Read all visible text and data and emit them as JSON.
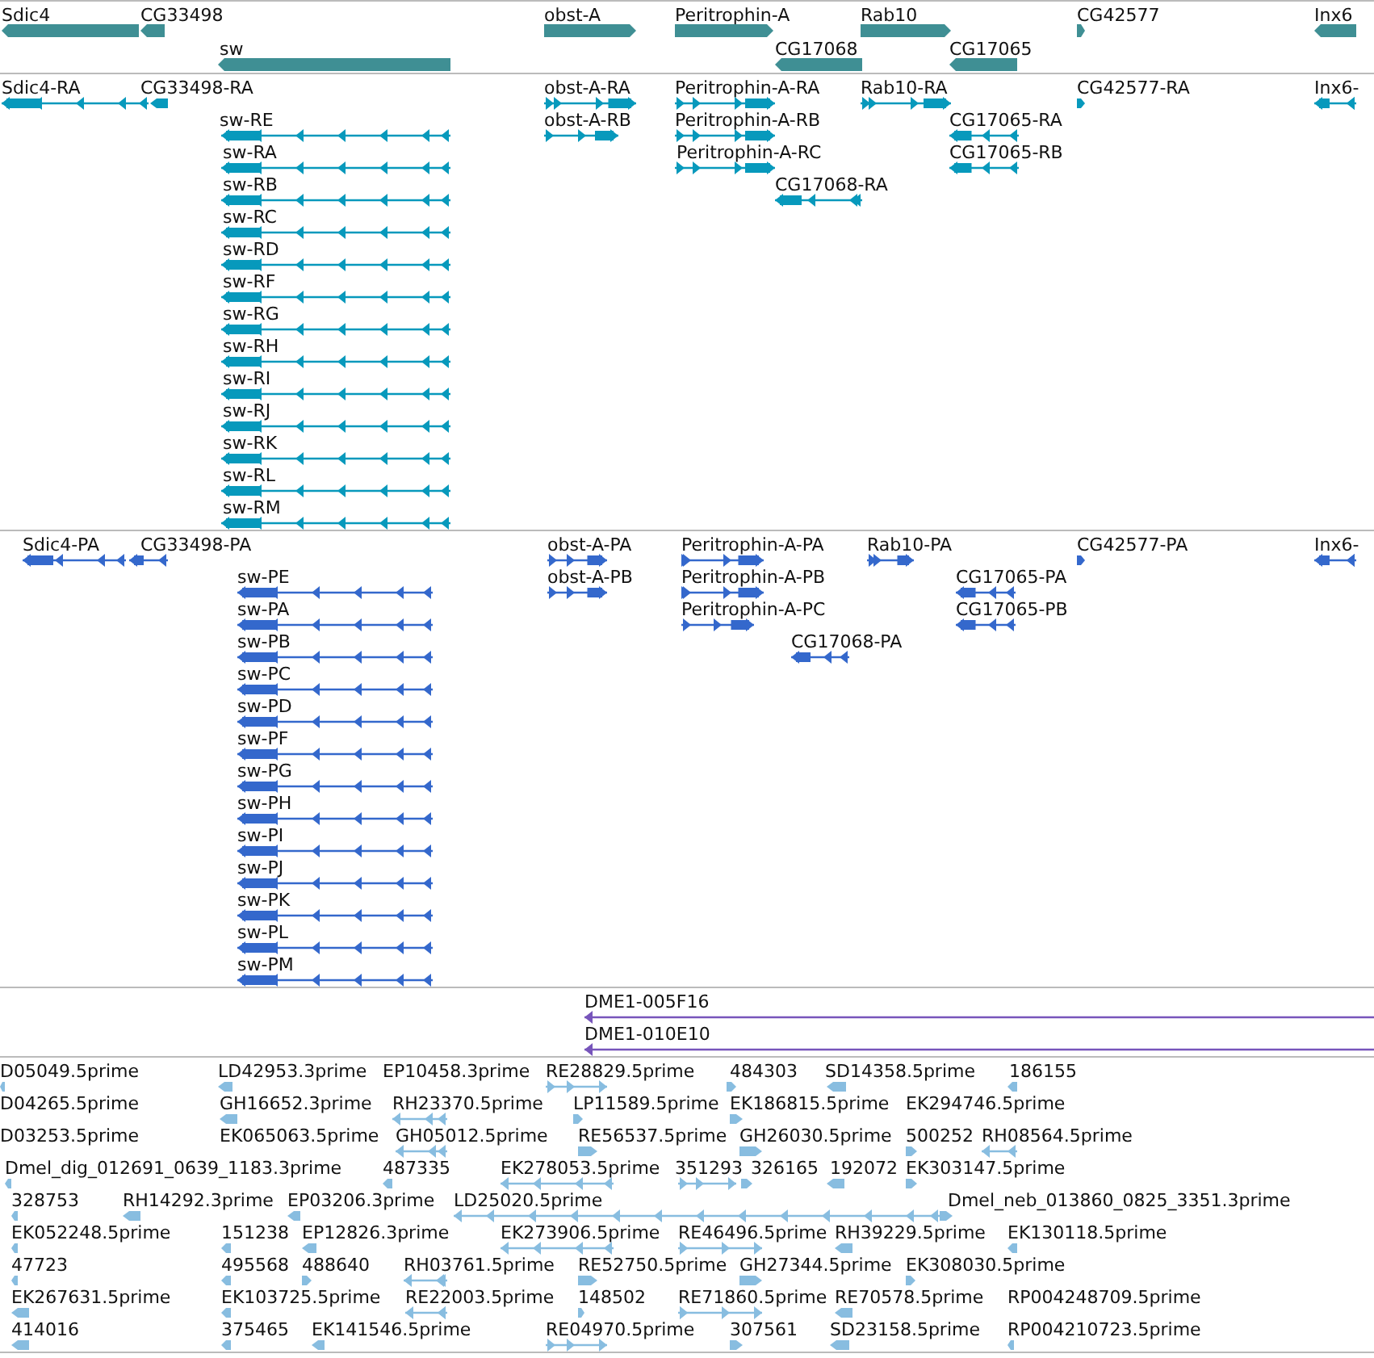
{
  "tracks": [
    {
      "kind": "gene",
      "features": [
        {
          "label": "Sdic4",
          "reverse": true
        },
        {
          "label": "CG33498",
          "reverse": true
        },
        {
          "label": "obst-A",
          "reverse": false
        },
        {
          "label": "Peritrophin-A",
          "reverse": false
        },
        {
          "label": "Rab10",
          "reverse": false
        },
        {
          "label": "CG42577",
          "reverse": false
        },
        {
          "label": "Inx6",
          "reverse": true
        },
        {
          "label": "sw",
          "reverse": true
        },
        {
          "label": "CG17068",
          "reverse": true
        },
        {
          "label": "CG17065",
          "reverse": true
        }
      ]
    },
    {
      "kind": "transcript",
      "features": [
        {
          "label": "Sdic4-RA",
          "reverse": true
        },
        {
          "label": "CG33498-RA",
          "reverse": true
        },
        {
          "label": "obst-A-RA",
          "reverse": false
        },
        {
          "label": "Peritrophin-A-RA",
          "reverse": false
        },
        {
          "label": "Rab10-RA",
          "reverse": false
        },
        {
          "label": "CG42577-RA",
          "reverse": false
        },
        {
          "label": "Inx6-",
          "reverse": true
        },
        {
          "label": "sw-RE",
          "reverse": true
        },
        {
          "label": "obst-A-RB",
          "reverse": false
        },
        {
          "label": "Peritrophin-A-RB",
          "reverse": false
        },
        {
          "label": "CG17065-RA",
          "reverse": true
        },
        {
          "label": "sw-RA",
          "reverse": true
        },
        {
          "label": "Peritrophin-A-RC",
          "reverse": false
        },
        {
          "label": "CG17065-RB",
          "reverse": true
        },
        {
          "label": "sw-RB",
          "reverse": true
        },
        {
          "label": "CG17068-RA",
          "reverse": true
        },
        {
          "label": "sw-RC",
          "reverse": true
        },
        {
          "label": "sw-RD",
          "reverse": true
        },
        {
          "label": "sw-RF",
          "reverse": true
        },
        {
          "label": "sw-RG",
          "reverse": true
        },
        {
          "label": "sw-RH",
          "reverse": true
        },
        {
          "label": "sw-RI",
          "reverse": true
        },
        {
          "label": "sw-RJ",
          "reverse": true
        },
        {
          "label": "sw-RK",
          "reverse": true
        },
        {
          "label": "sw-RL",
          "reverse": true
        },
        {
          "label": "sw-RM",
          "reverse": true
        }
      ]
    },
    {
      "kind": "protein",
      "features": [
        {
          "label": "Sdic4-PA",
          "reverse": true
        },
        {
          "label": "CG33498-PA",
          "reverse": true
        },
        {
          "label": "obst-A-PA",
          "reverse": false
        },
        {
          "label": "Peritrophin-A-PA",
          "reverse": false
        },
        {
          "label": "Rab10-PA",
          "reverse": false
        },
        {
          "label": "CG42577-PA",
          "reverse": false
        },
        {
          "label": "Inx6-",
          "reverse": true
        },
        {
          "label": "sw-PE",
          "reverse": true
        },
        {
          "label": "obst-A-PB",
          "reverse": false
        },
        {
          "label": "Peritrophin-A-PB",
          "reverse": false
        },
        {
          "label": "CG17065-PA",
          "reverse": true
        },
        {
          "label": "sw-PA",
          "reverse": true
        },
        {
          "label": "Peritrophin-A-PC",
          "reverse": false
        },
        {
          "label": "CG17065-PB",
          "reverse": true
        },
        {
          "label": "sw-PB",
          "reverse": true
        },
        {
          "label": "CG17068-PA",
          "reverse": true
        },
        {
          "label": "sw-PC",
          "reverse": true
        },
        {
          "label": "sw-PD",
          "reverse": true
        },
        {
          "label": "sw-PF",
          "reverse": true
        },
        {
          "label": "sw-PG",
          "reverse": true
        },
        {
          "label": "sw-PH",
          "reverse": true
        },
        {
          "label": "sw-PI",
          "reverse": true
        },
        {
          "label": "sw-PJ",
          "reverse": true
        },
        {
          "label": "sw-PK",
          "reverse": true
        },
        {
          "label": "sw-PL",
          "reverse": true
        },
        {
          "label": "sw-PM",
          "reverse": true
        }
      ]
    },
    {
      "kind": "clone",
      "features": [
        {
          "label": "DME1-005F16",
          "reverse": true
        },
        {
          "label": "DME1-010E10",
          "reverse": true
        }
      ]
    },
    {
      "kind": "est",
      "features": [
        {
          "label": "D05049.5prime",
          "reverse": true
        },
        {
          "label": "LD42953.3prime",
          "reverse": true
        },
        {
          "label": "EP10458.3prime"
        },
        {
          "label": "RE28829.5prime",
          "reverse": false
        },
        {
          "label": "484303",
          "reverse": false
        },
        {
          "label": "SD14358.5prime",
          "reverse": true
        },
        {
          "label": "186155",
          "reverse": true
        },
        {
          "label": "D04265.5prime"
        },
        {
          "label": "GH16652.3prime",
          "reverse": true
        },
        {
          "label": "RH23370.5prime",
          "reverse": true
        },
        {
          "label": "LP11589.5prime",
          "reverse": false
        },
        {
          "label": "EK186815.5prime",
          "reverse": false
        },
        {
          "label": "EK294746.5prime"
        },
        {
          "label": "D03253.5prime"
        },
        {
          "label": "EK065063.5prime"
        },
        {
          "label": "GH05012.5prime",
          "reverse": true
        },
        {
          "label": "RE56537.5prime",
          "reverse": false
        },
        {
          "label": "GH26030.5prime",
          "reverse": false
        },
        {
          "label": "500252",
          "reverse": false
        },
        {
          "label": "RH08564.5prime",
          "reverse": true
        },
        {
          "label": "Dmel_dig_012691_0639_1183.3prime",
          "reverse": true
        },
        {
          "label": "487335",
          "reverse": true
        },
        {
          "label": "EK278053.5prime",
          "reverse": true
        },
        {
          "label": "351293",
          "reverse": false
        },
        {
          "label": "326165",
          "reverse": false
        },
        {
          "label": "192072",
          "reverse": true
        },
        {
          "label": "EK303147.5prime",
          "reverse": false
        },
        {
          "label": "328753",
          "reverse": true
        },
        {
          "label": "RH14292.3prime",
          "reverse": true
        },
        {
          "label": "EP03206.3prime",
          "reverse": true
        },
        {
          "label": "LD25020.5prime",
          "reverse": true
        },
        {
          "label": "Dmel_neb_013860_0825_3351.3prime",
          "reverse": false
        },
        {
          "label": "EK052248.5prime",
          "reverse": true
        },
        {
          "label": "151238",
          "reverse": true
        },
        {
          "label": "EP12826.3prime",
          "reverse": true
        },
        {
          "label": "EK273906.5prime",
          "reverse": true
        },
        {
          "label": "RE46496.5prime",
          "reverse": false
        },
        {
          "label": "RH39229.5prime",
          "reverse": true
        },
        {
          "label": "EK130118.5prime",
          "reverse": true
        },
        {
          "label": "47723",
          "reverse": true
        },
        {
          "label": "495568",
          "reverse": true
        },
        {
          "label": "488640",
          "reverse": false
        },
        {
          "label": "RH03761.5prime",
          "reverse": true
        },
        {
          "label": "RE52750.5prime",
          "reverse": false
        },
        {
          "label": "GH27344.5prime",
          "reverse": false
        },
        {
          "label": "EK308030.5prime",
          "reverse": false
        },
        {
          "label": "EK267631.5prime",
          "reverse": true
        },
        {
          "label": "EK103725.5prime",
          "reverse": true
        },
        {
          "label": "RE22003.5prime",
          "reverse": true
        },
        {
          "label": "148502",
          "reverse": false
        },
        {
          "label": "RE71860.5prime",
          "reverse": false
        },
        {
          "label": "RE70578.5prime",
          "reverse": true
        },
        {
          "label": "RP004248709.5prime"
        },
        {
          "label": "414016",
          "reverse": true
        },
        {
          "label": "375465",
          "reverse": true
        },
        {
          "label": "EK141546.5prime",
          "reverse": true
        },
        {
          "label": "RE04970.5prime",
          "reverse": false
        },
        {
          "label": "307561",
          "reverse": false
        },
        {
          "label": "SD23158.5prime",
          "reverse": true
        },
        {
          "label": "RP004210723.5prime",
          "reverse": true
        }
      ]
    }
  ]
}
